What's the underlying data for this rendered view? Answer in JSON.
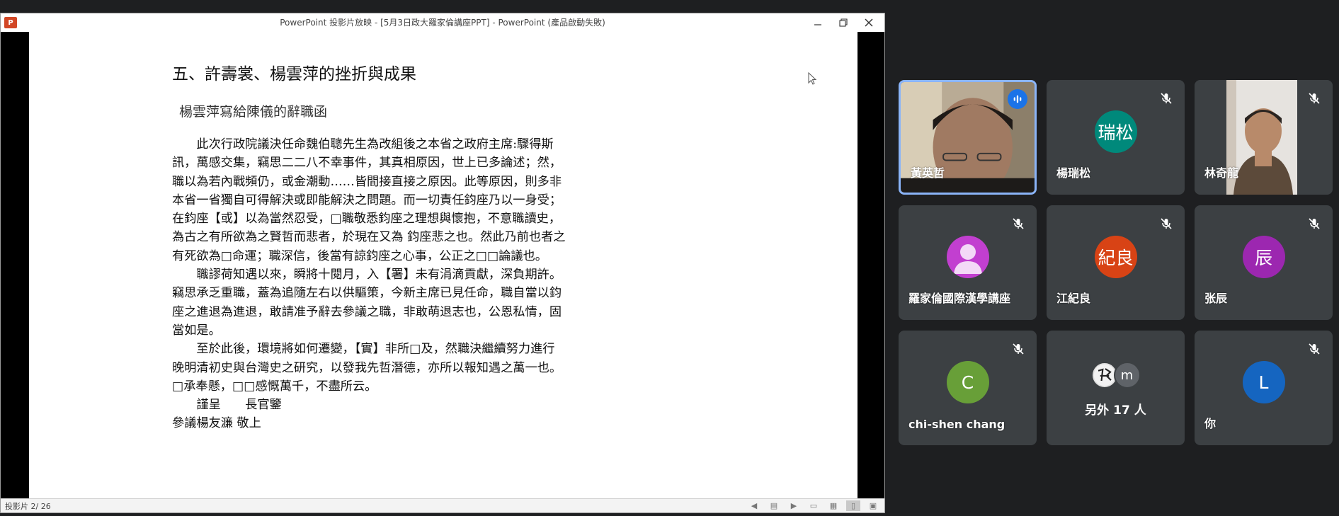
{
  "ppt": {
    "logo": "P",
    "title": "PowerPoint 投影片放映 - [5月3日政大羅家倫講座PPT] - PowerPoint (產品啟動失敗)",
    "status": "投影片 2/ 26",
    "icons": [
      "prev-icon",
      "notes-icon",
      "next-icon",
      "normal-view-icon",
      "slide-sorter-icon",
      "reading-view-icon",
      "slideshow-icon"
    ]
  },
  "slide": {
    "heading": "五、許壽裳、楊雲萍的挫折與成果",
    "subheading": "楊雲萍寫給陳儀的辭職函",
    "lines": [
      "　　此次行政院議決任命魏伯聰先生為改組後之本省之政府主席:驟得斯",
      "訊，萬感交集，竊思二二八不幸事件，其真相原因，世上已多論述；然，",
      "職以為若內戰頻仍，或金潮動……皆間接直接之原因。此等原因，則多非",
      "本省一省獨自可得解決或即能解決之問題。而一切責任鈞座乃以一身受；",
      "在鈞座【或】以為當然忍受，□職敬悉鈞座之理想與懷抱，不意職讀史，",
      "為古之有所欲為之賢哲而悲者，於現在又為 鈞座悲之也。然此乃前也者之",
      "有死欲為□命運；職深信，後當有諒鈞座之心事，公正之□□論議也。",
      "　　職謬荷知遇以來，瞬將十閱月，入【署】未有涓滴貢獻，深負期許。",
      "竊思承乏重職，蓋為追隨左右以供驅策，今新主席已見任命，職自當以鈞",
      "座之進退為進退，敢請准予辭去參議之職，非敢萌退志也，公恩私情，固",
      "當如是。",
      "　　至於此後，環境將如何遷變，【實】非所□及，然職決繼續努力進行",
      "晚明清初史與台灣史之研究，以發我先哲潛德，亦所以報知遇之萬一也。",
      "□承奉懸，□□感慨萬千，不盡所云。",
      "　　謹呈　　長官鑒",
      "參議楊友濂 敬上"
    ]
  },
  "meet": {
    "tiles": [
      {
        "name": "黃英哲",
        "type": "video",
        "speaking": true
      },
      {
        "name": "楊瑞松",
        "avatar_text": "瑞松",
        "color": "#00897b",
        "muted": true
      },
      {
        "name": "林奇龍",
        "type": "video",
        "muted": true
      },
      {
        "name": "羅家倫國際漢學講座",
        "avatar_text": "",
        "color": "#c23fd0",
        "muted": true
      },
      {
        "name": "江紀良",
        "avatar_text": "紀良",
        "color": "#d84315",
        "muted": true
      },
      {
        "name": "张辰",
        "avatar_text": "辰",
        "color": "#9c27b0",
        "muted": true
      },
      {
        "name": "chi-shen chang",
        "avatar_text": "C",
        "color": "#689f38",
        "muted": true
      },
      {
        "name": "另外 17 人",
        "mini": [
          "m"
        ],
        "color": "#5f6368"
      },
      {
        "name": "你",
        "avatar_text": "L",
        "color": "#1565c0",
        "muted": true
      }
    ]
  }
}
